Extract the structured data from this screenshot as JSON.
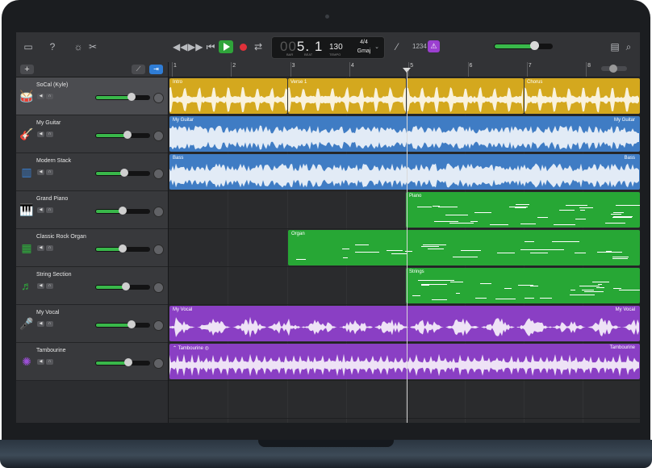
{
  "transport": {
    "position_bar": "5",
    "position_beat": "1",
    "position_prefix": "00",
    "bar_label": "BAR",
    "beat_label": "BEAT",
    "tempo": "130",
    "tempo_label": "TEMPO",
    "time_signature": "4/4",
    "key": "Gmaj",
    "count_in": "1234",
    "master_volume_level": 0.7
  },
  "ruler": {
    "bars": [
      "1",
      "2",
      "3",
      "4",
      "5",
      "6",
      "7",
      "8"
    ]
  },
  "tracks": [
    {
      "name": "SoCal (Kyle)",
      "icon": "drummer-icon",
      "icon_color": "#d9b321",
      "volume_level": 0.68,
      "selected": true
    },
    {
      "name": "My Guitar",
      "icon": "guitar-icon",
      "icon_color": "#3a7fd0",
      "volume_level": 0.6
    },
    {
      "name": "Modern Stack",
      "icon": "amp-icon",
      "icon_color": "#3a7fd0",
      "volume_level": 0.55
    },
    {
      "name": "Grand Piano",
      "icon": "piano-icon",
      "icon_color": "#2fae3c",
      "volume_level": 0.52
    },
    {
      "name": "Classic Rock Organ",
      "icon": "organ-icon",
      "icon_color": "#2fae3c",
      "volume_level": 0.52
    },
    {
      "name": "String Section",
      "icon": "strings-icon",
      "icon_color": "#2fae3c",
      "volume_level": 0.58
    },
    {
      "name": "My Vocal",
      "icon": "microphone-icon",
      "icon_color": "#9b4fd6",
      "volume_level": 0.68
    },
    {
      "name": "Tambourine",
      "icon": "tambourine-icon",
      "icon_color": "#9b4fd6",
      "volume_level": 0.62
    }
  ],
  "regions": {
    "drums": [
      {
        "label": "Intro"
      },
      {
        "label": "Verse 1"
      },
      {
        "label": ""
      },
      {
        "label": "Chorus"
      }
    ],
    "guitar": {
      "label": "My Guitar",
      "label_end": "My Guitar"
    },
    "bass": {
      "label": "Bass",
      "label_end": "Bass"
    },
    "piano": {
      "label": "Piano"
    },
    "organ": {
      "label": "Organ"
    },
    "strings": {
      "label": "Strings"
    },
    "vocal": {
      "label": "My Vocal",
      "label_end": "My Vocal"
    },
    "tambourine": {
      "label": "Tambourine",
      "label_end": "Tambourine"
    }
  },
  "colors": {
    "drummer": "#d4a81e",
    "audio_blue": "#3f7cc4",
    "midi_green": "#27a735",
    "vocal_purple": "#8a3fc4",
    "play": "#2fa43a",
    "record": "#e0313a",
    "metronome": "#9b3fd0"
  }
}
